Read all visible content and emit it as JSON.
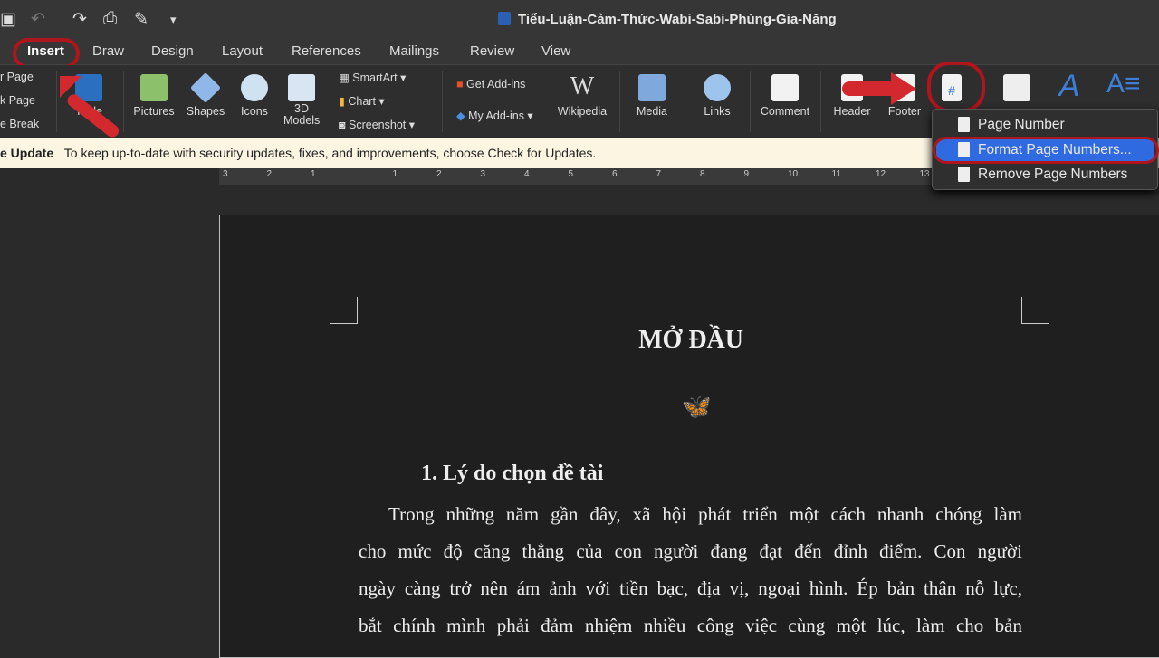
{
  "window": {
    "title": "Tiểu-Luận-Cảm-Thức-Wabi-Sabi-Phùng-Gia-Năng"
  },
  "quick_access": [
    "save-icon",
    "undo-icon",
    "redo-icon",
    "print-icon",
    "edit-icon",
    "customize-icon"
  ],
  "tabs": [
    "Insert",
    "Draw",
    "Design",
    "Layout",
    "References",
    "Mailings",
    "Review",
    "View"
  ],
  "ribbon": {
    "pages": [
      "r Page",
      "k Page",
      "e Break"
    ],
    "table": "Table",
    "pictures": "Pictures",
    "shapes": "Shapes",
    "icons": "Icons",
    "models": "3D Models",
    "smartart": "SmartArt",
    "chart": "Chart",
    "screenshot": "Screenshot",
    "get_addins": "Get Add-ins",
    "my_addins": "My Add-ins",
    "wikipedia": "Wikipedia",
    "media": "Media",
    "links": "Links",
    "comment": "Comment",
    "header": "Header",
    "footer": "Footer"
  },
  "update_bar": {
    "title": "e Update",
    "message": "To keep up-to-date with security updates, fixes, and improvements, choose Check for Updates."
  },
  "ruler": [
    "3",
    "2",
    "1",
    "1",
    "2",
    "3",
    "4",
    "5",
    "6",
    "7",
    "8",
    "9",
    "10",
    "11",
    "12",
    "13"
  ],
  "menu": {
    "items": [
      "Page Number",
      "Format Page Numbers...",
      "Remove Page Numbers"
    ],
    "selected": "Format Page Numbers..."
  },
  "document": {
    "heading": "MỞ ĐẦU",
    "section": "1. Lý do chọn đề tài",
    "lines": [
      "Trong những năm gần đây, xã hội phát triển một cách nhanh chóng làm",
      "cho mức độ căng thẳng của con người đang đạt đến đỉnh điểm. Con người",
      "ngày càng trở nên ám ảnh với tiền bạc, địa vị, ngoại hình. Ép bản thân nỗ lực,",
      "bắt chính mình phải đảm nhiệm nhiều công việc cùng một lúc, làm cho bản"
    ]
  },
  "colors": {
    "annotation": "#b0151b",
    "selection": "#2f6ae0",
    "update_bar": "#fbf5e2"
  }
}
